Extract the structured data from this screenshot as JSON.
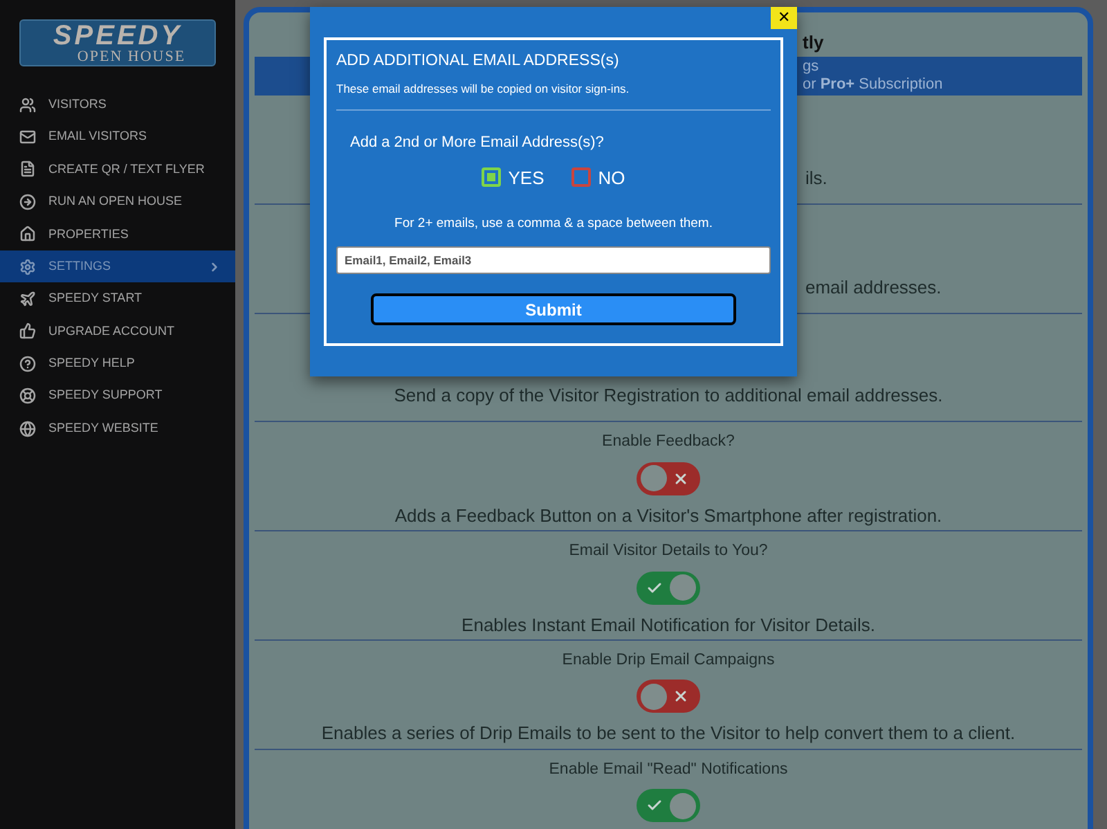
{
  "logo": {
    "title": "SPEEDY",
    "subtitle": "OPEN HOUSE"
  },
  "sidebar": {
    "items": [
      {
        "label": "VISITORS",
        "selected": false
      },
      {
        "label": "EMAIL VISITORS",
        "selected": false
      },
      {
        "label": "CREATE QR / TEXT FLYER",
        "selected": false
      },
      {
        "label": "RUN AN OPEN HOUSE",
        "selected": false
      },
      {
        "label": "PROPERTIES",
        "selected": false
      },
      {
        "label": "SETTINGS",
        "selected": true
      },
      {
        "label": "SPEEDY START",
        "selected": false
      },
      {
        "label": "UPGRADE ACCOUNT",
        "selected": false
      },
      {
        "label": "SPEEDY HELP",
        "selected": false
      },
      {
        "label": "SPEEDY SUPPORT",
        "selected": false
      },
      {
        "label": "SPEEDY WEBSITE",
        "selected": false
      }
    ]
  },
  "panel": {
    "heading": "tly",
    "banner_line_1": "gs",
    "banner_line_2": "or **Pro+** Subscription",
    "settings": [
      {
        "kind": "partial",
        "description": "ils."
      },
      {
        "kind": "partial",
        "description": "email addresses."
      },
      {
        "kind": "partial",
        "description": "Send a copy of the Visitor Registration to additional email addresses."
      },
      {
        "kind": "toggle",
        "label": "Enable Feedback?",
        "on": false,
        "description": "Adds a Feedback Button on a Visitor's Smartphone after registration."
      },
      {
        "kind": "toggle",
        "label": "Email Visitor Details to You?",
        "on": true,
        "description": "Enables Instant Email Notification for Visitor Details."
      },
      {
        "kind": "toggle",
        "label": "Enable Drip Email Campaigns",
        "on": false,
        "description": "Enables a series of Drip Emails to be sent to the Visitor to help convert them to a client."
      },
      {
        "kind": "toggle",
        "label": "Enable Email \"Read\" Notifications",
        "on": true
      }
    ]
  },
  "modal": {
    "close": "✕",
    "title": "ADD ADDITIONAL EMAIL ADDRESS(s)",
    "subtitle": "These email addresses will be copied on visitor sign-ins.",
    "question": "Add a 2nd or More Email Address(s)?",
    "options": [
      {
        "label": "YES",
        "selected": true
      },
      {
        "label": "NO",
        "selected": false
      }
    ],
    "hint": "For 2+ emails, use a comma & a space between them.",
    "input": {
      "placeholder": "Email1, Email2, Email3"
    },
    "submit": "Submit"
  }
}
